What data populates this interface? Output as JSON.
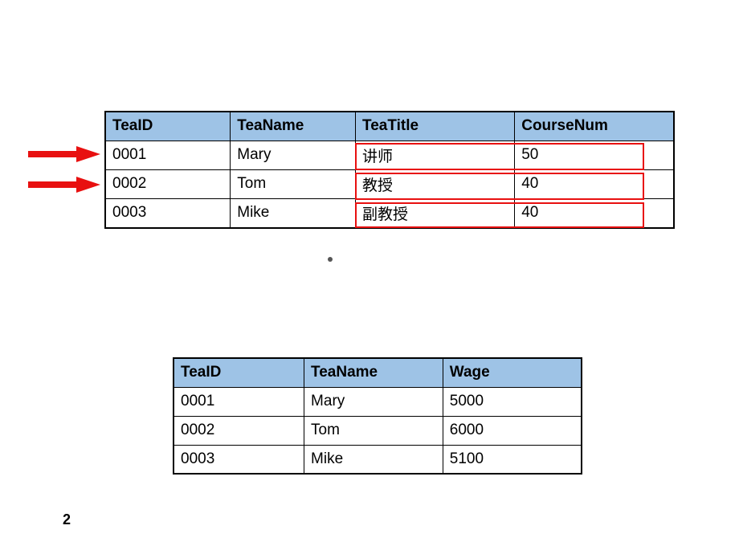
{
  "table1": {
    "headers": [
      "TeaID",
      "TeaName",
      "TeaTitle",
      "CourseNum"
    ],
    "rows": [
      [
        "0001",
        "Mary",
        "讲师",
        "50"
      ],
      [
        "0002",
        "Tom",
        "教授",
        "40"
      ],
      [
        "0003",
        "Mike",
        "副教授",
        "40"
      ]
    ]
  },
  "table2": {
    "headers": [
      "TeaID",
      "TeaName",
      "Wage"
    ],
    "rows": [
      [
        "0001",
        "Mary",
        "5000"
      ],
      [
        "0002",
        "Tom",
        "6000"
      ],
      [
        "0003",
        "Mike",
        "5100"
      ]
    ]
  },
  "pageNumber": "2"
}
